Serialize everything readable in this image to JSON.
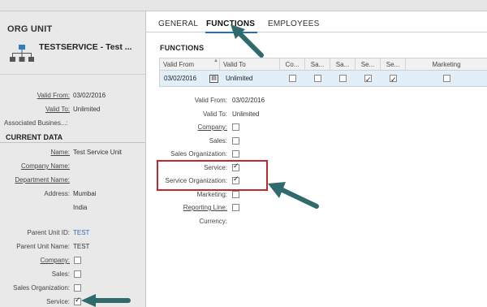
{
  "tabs": [
    {
      "label": "GENERAL"
    },
    {
      "label": "FUNCTIONS"
    },
    {
      "label": "EMPLOYEES"
    }
  ],
  "left": {
    "title": "ORG UNIT",
    "name": "TESTSERVICE - Test ...",
    "valid_from": {
      "label": "Valid From:",
      "value": "03/02/2016"
    },
    "valid_to": {
      "label": "Valid To:",
      "value": "Unlimited"
    },
    "associated": {
      "label": "Associated Busines...:",
      "value": ""
    },
    "current_data_header": "CURRENT DATA",
    "name_field": {
      "label": "Name:",
      "value": "Test Service Unit"
    },
    "company_name": {
      "label": "Company Name:",
      "value": ""
    },
    "department_name": {
      "label": "Department Name:",
      "value": ""
    },
    "address": {
      "label": "Address:",
      "line1": "Mumbai",
      "line2": "India"
    },
    "parent_unit_id": {
      "label": "Parent Unit ID:",
      "value": "TEST"
    },
    "parent_unit_name": {
      "label": "Parent Unit Name:",
      "value": "TEST"
    },
    "company": {
      "label": "Company:",
      "checked": false
    },
    "sales": {
      "label": "Sales:",
      "checked": false
    },
    "sales_org": {
      "label": "Sales Organization:",
      "checked": false
    },
    "service": {
      "label": "Service:",
      "checked": true
    }
  },
  "functions": {
    "header": "FUNCTIONS",
    "columns": [
      "Valid From",
      "Valid To",
      "Co...",
      "Sa...",
      "Sa...",
      "Se...",
      "Se...",
      "Marketing"
    ],
    "rows": [
      {
        "valid_from": "03/02/2016",
        "calendar_icon": "calendar-icon",
        "valid_to": "Unlimited",
        "checks": [
          false,
          false,
          false,
          true,
          true,
          false
        ]
      }
    ],
    "form": {
      "valid_from": {
        "label": "Valid From:",
        "value": "03/02/2016"
      },
      "valid_to": {
        "label": "Valid To:",
        "value": "Unlimited"
      },
      "company": {
        "label": "Company:",
        "checked": false
      },
      "sales": {
        "label": "Sales:",
        "checked": false
      },
      "sales_org": {
        "label": "Sales Organization:",
        "checked": false
      },
      "service": {
        "label": "Service:",
        "checked": true
      },
      "service_org": {
        "label": "Service Organization:",
        "checked": true
      },
      "marketing": {
        "label": "Marketing:",
        "checked": false
      },
      "reporting_line": {
        "label": "Reporting Line:",
        "checked": false
      },
      "currency": {
        "label": "Currency:",
        "value": ""
      }
    }
  },
  "colors": {
    "highlight_box": "#c0282e",
    "arrow": "#2f6b6d",
    "selected_row": "#e1eff9",
    "tab_accent": "#2a6ebb"
  }
}
